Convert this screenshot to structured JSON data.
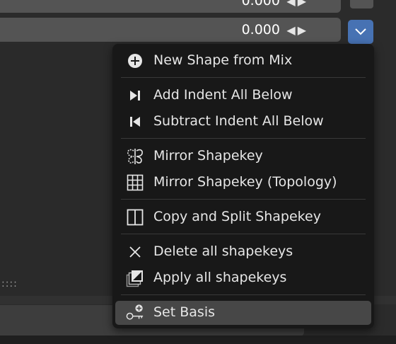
{
  "fields": {
    "row1_value": "0.000",
    "row2_value": "0.000"
  },
  "menu": {
    "items": [
      {
        "label": "New Shape from Mix",
        "icon": "add-circle-icon"
      },
      {
        "label": "Add Indent All Below",
        "icon": "indent-right-icon"
      },
      {
        "label": "Subtract Indent All Below",
        "icon": "indent-left-icon"
      },
      {
        "label": "Mirror Shapekey",
        "icon": "mirror-icon"
      },
      {
        "label": "Mirror Shapekey (Topology)",
        "icon": "grid-icon"
      },
      {
        "label": "Copy and Split Shapekey",
        "icon": "split-icon"
      },
      {
        "label": "Delete all shapekeys",
        "icon": "x-icon"
      },
      {
        "label": "Apply all shapekeys",
        "icon": "apply-stack-icon"
      },
      {
        "label": "Set Basis",
        "icon": "key-add-icon"
      }
    ]
  },
  "colors": {
    "accent": "#4772b3",
    "menu_bg": "#181818",
    "highlight": "#474747"
  }
}
